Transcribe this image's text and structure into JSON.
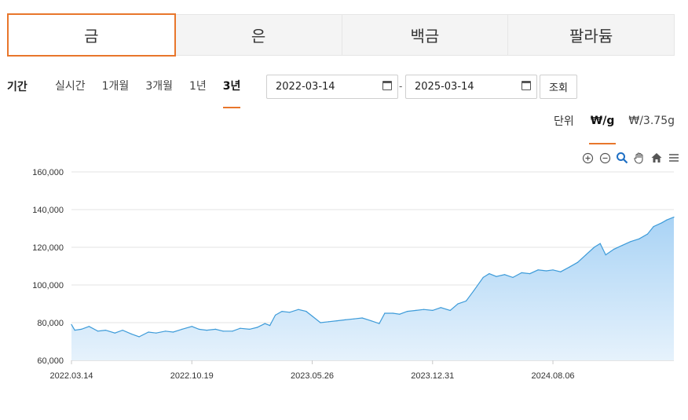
{
  "tabs": [
    {
      "label": "금",
      "active": true
    },
    {
      "label": "은",
      "active": false
    },
    {
      "label": "백금",
      "active": false
    },
    {
      "label": "팔라듐",
      "active": false
    }
  ],
  "period": {
    "label": "기간",
    "options": [
      "실시간",
      "1개월",
      "3개월",
      "1년",
      "3년"
    ],
    "selected": "3년",
    "start_date": "2022-03-14",
    "end_date": "2025-03-14",
    "separator": "-",
    "search_label": "조회"
  },
  "unit": {
    "label": "단위",
    "options": [
      "₩/g",
      "₩/3.75g"
    ],
    "selected": "₩/g"
  },
  "toolbar_icons": [
    "zoom-in-icon",
    "zoom-out-icon",
    "magnify-icon",
    "pan-hand-icon",
    "home-icon",
    "menu-icon"
  ],
  "colors": {
    "accent": "#e8762b",
    "line": "#3d9bd9",
    "fill_top": "#a9d3f5",
    "fill_bottom": "#e6f2fc"
  },
  "chart_data": {
    "type": "area",
    "title": "",
    "xlabel": "",
    "ylabel": "",
    "ylim": [
      60000,
      160000
    ],
    "yticks": [
      60000,
      80000,
      100000,
      120000,
      140000,
      160000
    ],
    "ytick_labels": [
      "60,000",
      "80,000",
      "100,000",
      "120,000",
      "140,000",
      "160,000"
    ],
    "xlim": [
      "2022-03-14",
      "2025-03-14"
    ],
    "xticks": [
      "2022-03-14",
      "2022-10-19",
      "2023-05-26",
      "2023-12-31",
      "2024-08-06"
    ],
    "xtick_labels": [
      "2022.03.14",
      "2022.10.19",
      "2023.05.26",
      "2023.12.31",
      "2024.08.06"
    ],
    "grid": true,
    "series": [
      {
        "x": [
          "2022-03-14",
          "2022-03-20",
          "2022-04-01",
          "2022-04-15",
          "2022-05-01",
          "2022-05-15",
          "2022-06-01",
          "2022-06-15",
          "2022-07-01",
          "2022-07-15",
          "2022-08-01",
          "2022-08-15",
          "2022-09-01",
          "2022-09-15",
          "2022-10-01",
          "2022-10-19",
          "2022-11-01",
          "2022-11-15",
          "2022-12-01",
          "2022-12-15",
          "2023-01-01",
          "2023-01-15",
          "2023-02-01",
          "2023-02-15",
          "2023-03-01",
          "2023-03-10",
          "2023-03-20",
          "2023-04-01",
          "2023-04-15",
          "2023-05-01",
          "2023-05-15",
          "2023-05-26",
          "2023-06-10",
          "2023-06-25",
          "2023-07-10",
          "2023-07-25",
          "2023-08-10",
          "2023-08-25",
          "2023-09-10",
          "2023-09-25",
          "2023-10-05",
          "2023-10-20",
          "2023-11-01",
          "2023-11-15",
          "2023-12-01",
          "2023-12-15",
          "2023-12-31",
          "2024-01-15",
          "2024-02-01",
          "2024-02-15",
          "2024-03-01",
          "2024-03-15",
          "2024-04-01",
          "2024-04-12",
          "2024-04-25",
          "2024-05-10",
          "2024-05-25",
          "2024-06-10",
          "2024-06-25",
          "2024-07-10",
          "2024-07-25",
          "2024-08-06",
          "2024-08-20",
          "2024-09-05",
          "2024-09-20",
          "2024-10-05",
          "2024-10-20",
          "2024-10-31",
          "2024-11-10",
          "2024-11-25",
          "2024-12-10",
          "2024-12-25",
          "2025-01-10",
          "2025-01-25",
          "2025-02-05",
          "2025-02-20",
          "2025-03-01",
          "2025-03-14"
        ],
        "values": [
          79000,
          76000,
          76500,
          78000,
          75500,
          76000,
          74500,
          76000,
          74000,
          72500,
          75000,
          74500,
          75500,
          75000,
          76500,
          78000,
          76500,
          76000,
          76500,
          75500,
          75500,
          77000,
          76500,
          77500,
          79500,
          78500,
          84000,
          86000,
          85500,
          87000,
          86000,
          83500,
          80000,
          80500,
          81000,
          81500,
          82000,
          82500,
          81000,
          79500,
          85000,
          85000,
          84500,
          86000,
          86500,
          87000,
          86500,
          88000,
          86500,
          90000,
          91500,
          97000,
          104000,
          106000,
          104500,
          105500,
          104000,
          106500,
          106000,
          108000,
          107500,
          108000,
          107000,
          109500,
          112000,
          116000,
          120000,
          122000,
          116000,
          119000,
          121000,
          123000,
          124500,
          127000,
          131000,
          133000,
          134500,
          136000
        ]
      }
    ]
  }
}
